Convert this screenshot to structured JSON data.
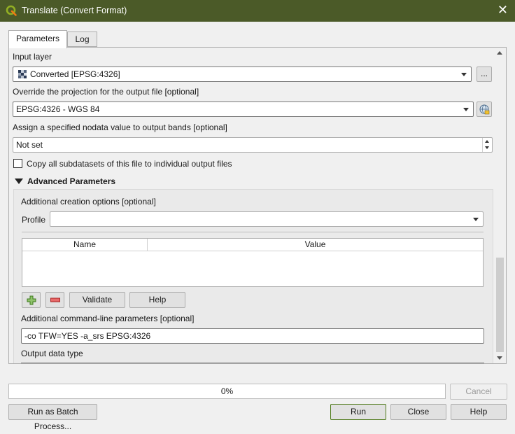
{
  "window": {
    "title": "Translate (Convert Format)",
    "close_symbol": "✕",
    "accent_color": "#4b5a28"
  },
  "tabs": [
    {
      "label": "Parameters",
      "active": true
    },
    {
      "label": "Log",
      "active": false
    }
  ],
  "params": {
    "input_layer_label": "Input layer",
    "input_layer_value": "Converted [EPSG:4326]",
    "input_layer_icon": "raster-layer-icon",
    "ellipsis_label": "...",
    "override_proj_label": "Override the projection for the output file [optional]",
    "override_proj_value": "EPSG:4326 - WGS 84",
    "crs_icon": "crs-globe-icon",
    "nodata_label": "Assign a specified nodata value to output bands [optional]",
    "nodata_value": "Not set",
    "copy_subdatasets_label": "Copy all subdatasets of this file to individual output files",
    "copy_subdatasets_checked": false
  },
  "advanced": {
    "header_label": "Advanced Parameters",
    "creation_options_label": "Additional creation options [optional]",
    "profile_label": "Profile",
    "profile_value": "",
    "table_headers": [
      "Name",
      "Value"
    ],
    "table_rows": [],
    "add_icon": "plus-icon",
    "remove_icon": "minus-icon",
    "validate_label": "Validate",
    "help_label": "Help",
    "cmdline_label": "Additional command-line parameters [optional]",
    "cmdline_value": "-co TFW=YES -a_srs EPSG:4326",
    "output_type_label": "Output data type"
  },
  "footer": {
    "progress_text": "0%",
    "progress_value": 0,
    "cancel_label": "Cancel",
    "batch_label": "Run as Batch Process...",
    "run_label": "Run",
    "close_label": "Close",
    "help_label": "Help"
  }
}
